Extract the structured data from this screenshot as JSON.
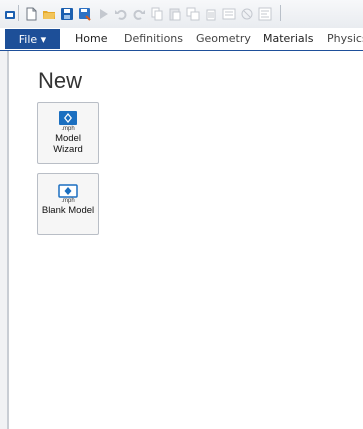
{
  "ribbon": {
    "file_label": "File ▾",
    "tabs": [
      "Home",
      "Definitions",
      "Geometry",
      "Materials",
      "Physics"
    ]
  },
  "main": {
    "heading": "New",
    "tiles": [
      {
        "ext": ".mph",
        "line1": "Model",
        "line2": "Wizard"
      },
      {
        "ext": ".mph",
        "line1": "Blank Model"
      }
    ]
  },
  "colors": {
    "accent": "#1d4f98",
    "icon_blue": "#1b6fc0"
  }
}
